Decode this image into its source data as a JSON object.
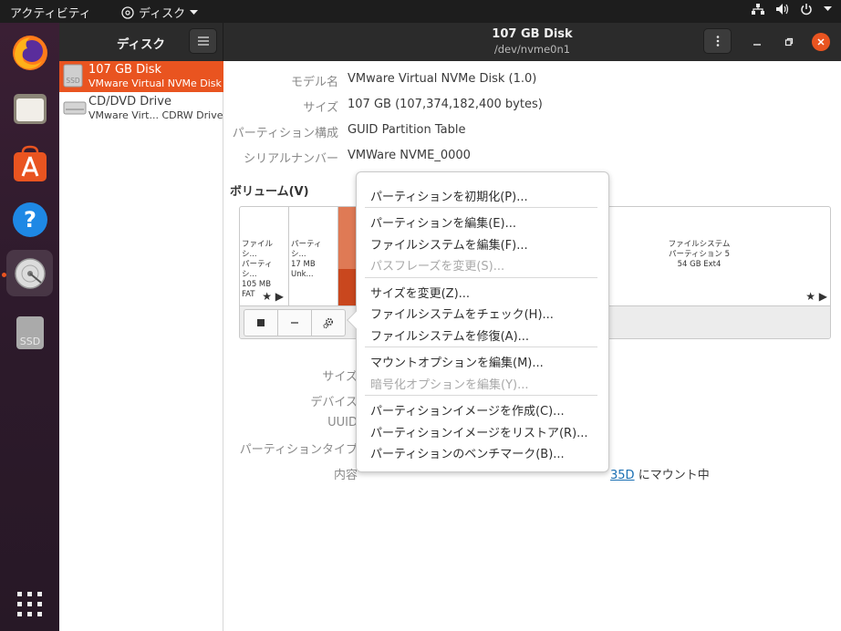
{
  "topbar": {
    "activities": "アクティビティ",
    "app_name": "ディスク"
  },
  "dock": {
    "items": [
      "firefox-icon",
      "files-icon",
      "software-icon",
      "help-icon",
      "disks-icon",
      "ssd-icon"
    ]
  },
  "sidebar": {
    "title": "ディスク",
    "disks": [
      {
        "name": "107 GB Disk",
        "model": "VMware Virtual NVMe Disk",
        "icon_label": "SSD"
      },
      {
        "name": "CD/DVD Drive",
        "model": "VMware Virt... CDRW Drive"
      }
    ]
  },
  "header": {
    "title": "107 GB Disk",
    "subtitle": "/dev/nvme0n1"
  },
  "details": {
    "rows": [
      {
        "label": "モデル名",
        "value": "VMware Virtual NVMe Disk (1.0)"
      },
      {
        "label": "サイズ",
        "value": "107 GB (107,374,182,400 bytes)"
      },
      {
        "label": "パーティション構成",
        "value": "GUID Partition Table"
      },
      {
        "label": "シリアルナンバー",
        "value": "VMWare NVME_0000"
      }
    ],
    "volumes_title": "ボリューム(V)",
    "partition_labels": [
      "サイズ",
      "デバイス",
      "UUID",
      "パーティションタイプ",
      "内容"
    ],
    "content_link": "35D",
    "content_suffix": "にマウント中"
  },
  "volumes": [
    {
      "l1": "ファイルシ...",
      "l2": "パーティシ...",
      "l3": "105 MB FAT",
      "color": "#ffffff"
    },
    {
      "l1": "パーティシ...",
      "l2": "17 MB Unk...",
      "l3": "",
      "color": "#ffffff"
    },
    {
      "l1": "",
      "l2": "",
      "l3": "",
      "color": "#e0784e"
    },
    {
      "l1": "ファイルシステム",
      "l2": "パーティション 5",
      "l3": "54 GB Ext4",
      "color": "#ffffff"
    }
  ],
  "menu": {
    "items": [
      {
        "label": "パーティションを初期化(P)...",
        "disabled": false
      },
      {
        "label": "パーティションを編集(E)...",
        "disabled": false
      },
      {
        "label": "ファイルシステムを編集(F)...",
        "disabled": false
      },
      {
        "label": "パスフレーズを変更(S)...",
        "disabled": true
      },
      {
        "label": "サイズを変更(Z)...",
        "disabled": false
      },
      {
        "label": "ファイルシステムをチェック(H)...",
        "disabled": false
      },
      {
        "label": "ファイルシステムを修復(A)...",
        "disabled": false
      },
      {
        "label": "マウントオプションを編集(M)...",
        "disabled": false
      },
      {
        "label": "暗号化オプションを編集(Y)...",
        "disabled": true
      },
      {
        "label": "パーティションイメージを作成(C)...",
        "disabled": false
      },
      {
        "label": "パーティションイメージをリストア(R)...",
        "disabled": false
      },
      {
        "label": "パーティションのベンチマーク(B)...",
        "disabled": false
      }
    ]
  },
  "colors": {
    "accent": "#e95420",
    "headerbar": "#2b2b2b"
  }
}
